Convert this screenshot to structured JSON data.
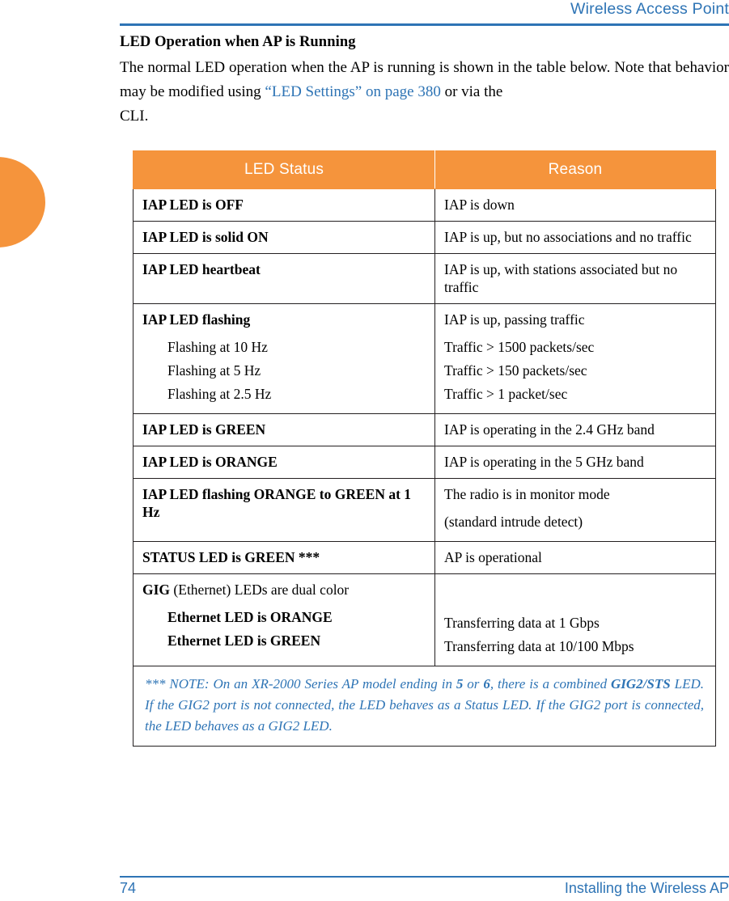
{
  "header": {
    "title": "Wireless Access Point"
  },
  "content": {
    "section_title": "LED Operation when AP is Running",
    "intro_part1": "The normal LED operation when the AP is running is shown in the table below. Note that behavior may be modified using ",
    "intro_link": "“LED Settings” on page 380",
    "intro_part2": " or via the",
    "intro_part3": "CLI."
  },
  "table": {
    "columns": [
      "LED Status",
      "Reason"
    ],
    "rows": [
      {
        "status": "IAP LED is OFF",
        "reason": "IAP is down"
      },
      {
        "status": "IAP LED is solid ON",
        "reason": "IAP is up, but no associations and no traffic"
      },
      {
        "status": "IAP LED heartbeat",
        "reason": "IAP is up, with stations associated but no traffic"
      },
      {
        "status": "IAP LED flashing",
        "status_subs": [
          "Flashing at 10 Hz",
          "Flashing at 5 Hz",
          "Flashing at 2.5 Hz"
        ],
        "reason": "IAP is up, passing traffic",
        "reason_subs": [
          "Traffic > 1500 packets/sec",
          "Traffic > 150 packets/sec",
          "Traffic > 1 packet/sec"
        ]
      },
      {
        "status": "IAP LED is GREEN",
        "reason": "IAP is operating in the 2.4 GHz band"
      },
      {
        "status": "IAP LED is ORANGE",
        "reason": "IAP is operating in the 5 GHz band"
      },
      {
        "status": "IAP LED flashing ORANGE to GREEN at 1 Hz",
        "reason": "The radio is in monitor mode",
        "reason_extra": "(standard intrude detect)"
      },
      {
        "status": "STATUS LED is GREEN ***",
        "reason": "AP is operational"
      },
      {
        "status_bold": "GIG",
        "status_rest": " (Ethernet) LEDs are dual color",
        "status_subs": [
          "Ethernet LED is ORANGE",
          "Ethernet LED is GREEN"
        ],
        "reason": "",
        "reason_subs": [
          "Transferring data at 1 Gbps",
          "Transferring data at 10/100 Mbps"
        ]
      }
    ],
    "note": {
      "p1": "*** NOTE: On an XR-2000 Series AP model ending in ",
      "b1": "5",
      "p2": " or ",
      "b2": "6",
      "p3": ", there is a combined ",
      "b3": "GIG2/STS",
      "p4": " LED. If the GIG2 port is not connected, the LED behaves as a Status LED. If the GIG2 port is connected, the LED behaves as a GIG2 LED."
    }
  },
  "footer": {
    "page_number": "74",
    "section": "Installing the Wireless AP"
  },
  "colors": {
    "accent_orange": "#F5943C",
    "accent_blue": "#2E74B5",
    "rule": "#231f20"
  }
}
